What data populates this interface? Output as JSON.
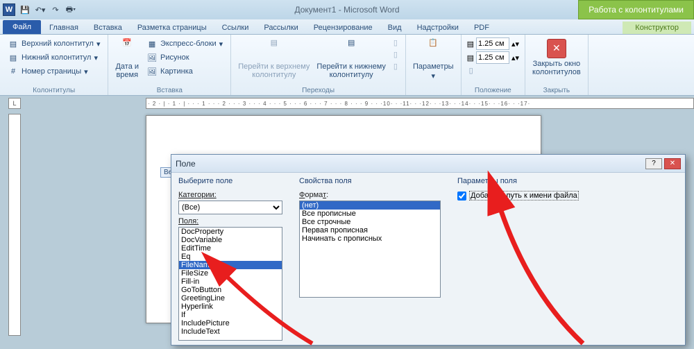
{
  "title": "Документ1 - Microsoft Word",
  "context_tab": "Работа с колонтитулами",
  "tabs": {
    "file": "Файл",
    "home": "Главная",
    "insert": "Вставка",
    "layout": "Разметка страницы",
    "refs": "Ссылки",
    "mail": "Рассылки",
    "review": "Рецензирование",
    "view": "Вид",
    "addins": "Надстройки",
    "pdf": "PDF",
    "designer": "Конструктор"
  },
  "ribbon": {
    "g1": {
      "hdr": "Верхний колонтитул",
      "ftr": "Нижний колонтитул",
      "pgn": "Номер страницы",
      "label": "Колонтитулы"
    },
    "g2": {
      "date": "Дата и\nвремя",
      "parts": "Экспресс-блоки",
      "pic": "Рисунок",
      "clip": "Картинка",
      "label": "Вставка"
    },
    "g3": {
      "prev": "Перейти к верхнему\nколонтитулу",
      "next": "Перейти к нижнему\nколонтитулу",
      "label": "Переходы"
    },
    "g4": {
      "params": "Параметры",
      "label": ""
    },
    "g5": {
      "top": "1.25 см",
      "bot": "1.25 см",
      "label": "Положение"
    },
    "g6": {
      "close": "Закрыть окно\nколонтитулов",
      "label": "Закрыть"
    }
  },
  "header_tag": "Вер",
  "dialog": {
    "title": "Поле",
    "col1": {
      "h": "Выберите поле",
      "cat_lbl": "Категории:",
      "cat_val": "(Все)",
      "fields_lbl": "Поля:",
      "fields": [
        "DocProperty",
        "DocVariable",
        "EditTime",
        "Eq",
        "FileName",
        "FileSize",
        "Fill-in",
        "GoToButton",
        "GreetingLine",
        "Hyperlink",
        "If",
        "IncludePicture",
        "IncludeText"
      ],
      "sel": "FileName"
    },
    "col2": {
      "h": "Свойства поля",
      "fmt_lbl": "Формат:",
      "formats": [
        "(нет)",
        "Все прописные",
        "Все строчные",
        "Первая прописная",
        "Начинать с прописных"
      ],
      "sel": "(нет)"
    },
    "col3": {
      "h": "Параметры поля",
      "chk": "Добавить путь к имени файла"
    }
  }
}
